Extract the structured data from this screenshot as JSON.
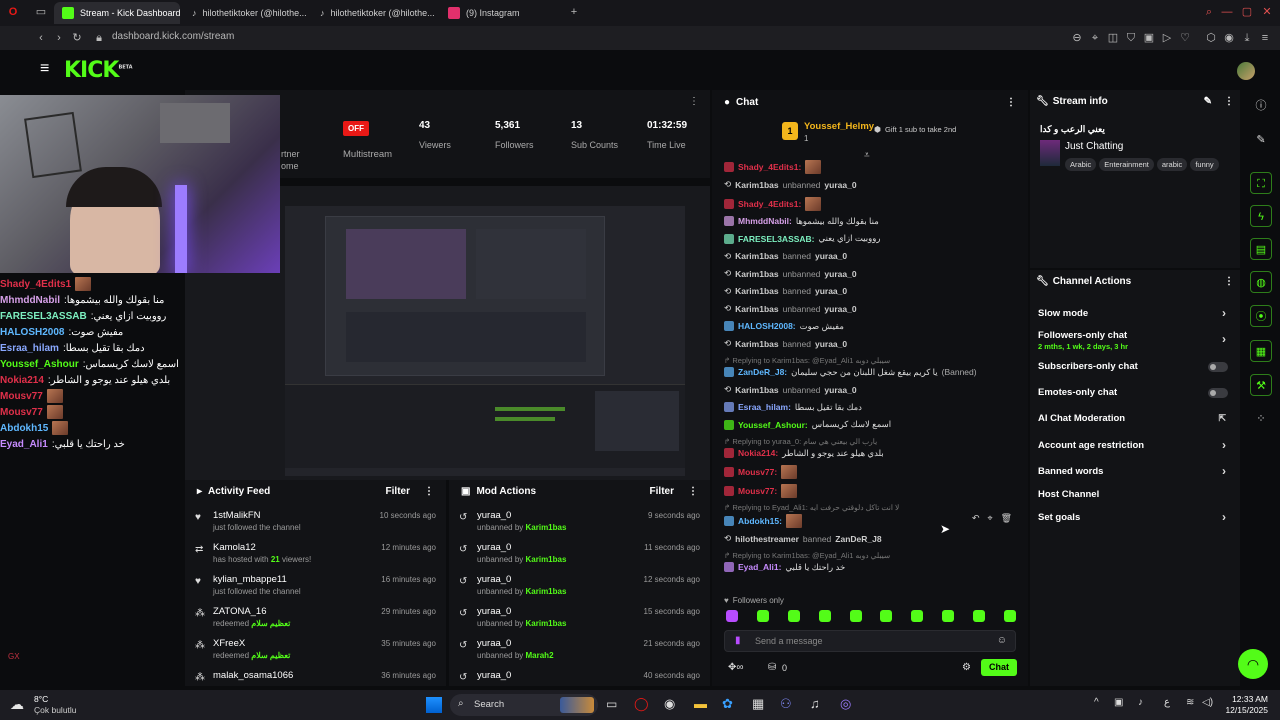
{
  "browser": {
    "tabs": [
      {
        "label": "Stream - Kick Dashboard",
        "color": "#53fc18"
      },
      {
        "label": "hilothetiktoker (@hilothe...",
        "color": "#222222"
      },
      {
        "label": "hilothetiktoker (@hilothe...",
        "color": "#222222"
      },
      {
        "label": "(9) Instagram",
        "color": "#e1306c"
      }
    ],
    "url": "dashboard.kick.com/stream"
  },
  "kick": {
    "logo": "KICK",
    "logo_sup": "BETA"
  },
  "stats": {
    "partner_label_1": "rtner",
    "partner_label_2": "ome",
    "offline_badge": "OFF",
    "multistream": "Multistream",
    "viewers_value": "43",
    "viewers_label": "Viewers",
    "followers_value": "5,361",
    "followers_label": "Followers",
    "subs_value": "13",
    "subs_label": "Sub Counts",
    "time_value": "01:32:59",
    "time_label": "Time Live"
  },
  "overlay_chat": [
    {
      "user": "Shady_4Edits1",
      "color": "#e0304a",
      "text": ""
    },
    {
      "user": "MhmddNabil",
      "color": "#d6a0e8",
      "text": ":منا بقولك والله بيشموها"
    },
    {
      "user": "FARESEL3ASSAB",
      "color": "#7df0c0",
      "text": ":رووبيت ازاي يعني"
    },
    {
      "user": "HALOSH2008",
      "color": "#5fb8ff",
      "text": ":مفيش صوت"
    },
    {
      "user": "Esraa_hilam",
      "color": "#8aa8ff",
      "text": ":دمك بقا تقيل بسطا"
    },
    {
      "user": "Youssef_Ashour",
      "color": "#53fc18",
      "text": ":اسمع لاسك كريسماس"
    },
    {
      "user": "Nokia214",
      "color": "#e0304a",
      "text": ":بلدي هيلو عند يوجو و الشاطر"
    },
    {
      "user": "Mousv77",
      "color": "#e0304a",
      "text": ""
    },
    {
      "user": "Mousv77",
      "color": "#e0304a",
      "text": ""
    },
    {
      "user": "Abdokh15",
      "color": "#5fb8ff",
      "text": ""
    },
    {
      "user": "Eyad_Ali1",
      "color": "#c78cff",
      "text": ":خد راحتك يا قلبي"
    }
  ],
  "activity_feed": {
    "title": "Activity Feed",
    "filter": "Filter",
    "items": [
      {
        "icon": "heart",
        "name": "1stMalikFN",
        "sub": "just followed the channel",
        "time": "10 seconds ago"
      },
      {
        "icon": "host",
        "name": "Kamola12",
        "sub": "has hosted with",
        "sub_count": "21",
        "sub_tail": "viewers!",
        "time": "12 minutes ago"
      },
      {
        "icon": "heart",
        "name": "kylian_mbappe11",
        "sub": "just followed the channel",
        "time": "16 minutes ago"
      },
      {
        "icon": "redeem",
        "name": "ZATONA_16",
        "sub": "redeemed",
        "sub_green": "تعظيم سلام",
        "time": "29 minutes ago"
      },
      {
        "icon": "redeem",
        "name": "XFreeX",
        "sub": "redeemed",
        "sub_green": "تعظيم سلام",
        "time": "35 minutes ago"
      },
      {
        "icon": "redeem",
        "name": "malak_osama1066",
        "sub": "",
        "time": "36 minutes ago"
      }
    ]
  },
  "mod_actions": {
    "title": "Mod Actions",
    "filter": "Filter",
    "items": [
      {
        "name": "yuraa_0",
        "sub": "unbanned by",
        "by": "Karim1bas",
        "time": "9 seconds ago"
      },
      {
        "name": "yuraa_0",
        "sub": "unbanned by",
        "by": "Karim1bas",
        "time": "11 seconds ago"
      },
      {
        "name": "yuraa_0",
        "sub": "unbanned by",
        "by": "Karim1bas",
        "time": "12 seconds ago"
      },
      {
        "name": "yuraa_0",
        "sub": "unbanned by",
        "by": "Karim1bas",
        "time": "15 seconds ago"
      },
      {
        "name": "yuraa_0",
        "sub": "unbanned by",
        "by": "Marah2",
        "time": "21 seconds ago"
      },
      {
        "name": "yuraa_0",
        "sub": "",
        "by": "",
        "time": "40 seconds ago"
      }
    ]
  },
  "chat": {
    "title": "Chat",
    "pinned_user": "Youssef_Helmy",
    "pinned_count": "1",
    "gift_text": "Gift 1 sub to take 2nd",
    "messages": [
      {
        "user": "Shady_4Edits1",
        "color": "#e0304a",
        "text": "",
        "emote": true
      },
      {
        "mod": "Karim1bas",
        "action": "unbanned",
        "target": "yuraa_0"
      },
      {
        "user": "Shady_4Edits1",
        "color": "#e0304a",
        "text": "",
        "emote": true
      },
      {
        "user": "MhmddNabil",
        "color": "#d6a0e8",
        "text": "منا بقولك والله بيشموها"
      },
      {
        "user": "FARESEL3ASSAB",
        "color": "#7df0c0",
        "text": "رووبيت ازاي يعني"
      },
      {
        "mod": "Karim1bas",
        "action": "banned",
        "target": "yuraa_0"
      },
      {
        "mod": "Karim1bas",
        "action": "unbanned",
        "target": "yuraa_0"
      },
      {
        "mod": "Karim1bas",
        "action": "banned",
        "target": "yuraa_0"
      },
      {
        "mod": "Karim1bas",
        "action": "unbanned",
        "target": "yuraa_0"
      },
      {
        "user": "HALOSH2008",
        "color": "#5fb8ff",
        "text": "مفيش صوت"
      },
      {
        "mod": "Karim1bas",
        "action": "banned",
        "target": "yuraa_0"
      },
      {
        "reply": "Replying to Karim1bas: @Eyad_Ali1 سيبلي دوبه"
      },
      {
        "user": "ZanDeR_J8",
        "color": "#5fb8ff",
        "text": "يا كريم بيقع شغل اللبنان من حجي سليمان",
        "tail": "(Banned)"
      },
      {
        "mod": "Karim1bas",
        "action": "unbanned",
        "target": "yuraa_0"
      },
      {
        "user": "Esraa_hilam",
        "color": "#8aa8ff",
        "text": "دمك بقا تقيل بسطا"
      },
      {
        "user": "Youssef_Ashour",
        "color": "#53fc18",
        "text": "اسمع لاسك كريسماس"
      },
      {
        "reply": "Replying to yuraa_0: يارب الي بيعني هي سام"
      },
      {
        "user": "Nokia214",
        "color": "#e0304a",
        "text": "بلدي هيلو عند يوجو و الشاطر"
      },
      {
        "user": "Mousv77",
        "color": "#e0304a",
        "text": "",
        "emote": true
      },
      {
        "user": "Mousv77",
        "color": "#e0304a",
        "text": "",
        "emote": true
      },
      {
        "reply": "Replying to Eyad_Ali1: لا انت تاكل دلوقتي حرفت ايه"
      },
      {
        "user": "Abdokh15",
        "color": "#5fb8ff",
        "text": "",
        "emote": true
      },
      {
        "mod": "hilothestreamer",
        "action": "banned",
        "target": "ZanDeR_J8"
      },
      {
        "reply": "Replying to Karim1bas: @Eyad_Ali1 سيبلي دوبه"
      },
      {
        "user": "Eyad_Ali1",
        "color": "#c78cff",
        "text": "خد راحتك يا قلبي"
      }
    ],
    "followers_only": "Followers only",
    "input_placeholder": "Send a message",
    "points": "0",
    "send_label": "Chat"
  },
  "stream_info": {
    "title": "Stream info",
    "stream_title": "يعني الرعب و كدا",
    "category": "Just Chatting",
    "tags": [
      "Arabic",
      "Enterainment",
      "arabic",
      "funny"
    ]
  },
  "channel_actions": {
    "title": "Channel Actions",
    "slow_mode": "Slow mode",
    "followers_only_chat": "Followers-only chat",
    "followers_only_value": "2 mths, 1 wk, 2 days, 3 hr",
    "subscribers_only_chat": "Subscribers-only chat",
    "emotes_only_chat": "Emotes-only chat",
    "ai_chat_moderation": "AI Chat Moderation",
    "account_age_restriction": "Account age restriction",
    "banned_words": "Banned words",
    "host_channel": "Host Channel",
    "set_goals": "Set goals"
  },
  "taskbar": {
    "weather_temp": "8°C",
    "weather_desc": "Çok bulutlu",
    "search": "Search",
    "time": "12:33 AM",
    "date": "12/15/2025"
  },
  "colors": {
    "accent": "#53fc18",
    "offline": "#e91916"
  }
}
